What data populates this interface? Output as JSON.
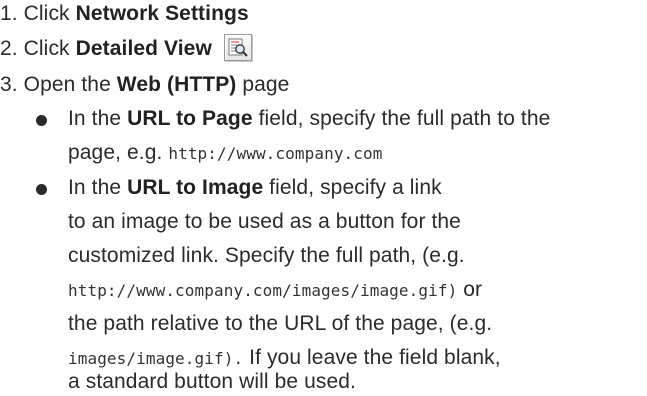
{
  "steps": [
    {
      "num": "1.",
      "text_before": "Click ",
      "bold": "Network Settings"
    },
    {
      "num": "2.",
      "text_before": "Click ",
      "bold": "Detailed View",
      "icon": "detailed-view-icon"
    },
    {
      "num": "3.",
      "text_before": "Open the ",
      "bold": "Web (HTTP)",
      "text_after": " page"
    }
  ],
  "bullets": [
    {
      "lines": [
        {
          "pre": "In the ",
          "bold": "URL to Page",
          "post": " field, specify the full path to the"
        },
        {
          "pre": "page, e.g. ",
          "mono": "http://www.company.com"
        }
      ]
    },
    {
      "lines": [
        {
          "pre": "In the ",
          "bold": "URL to Image",
          "post": " field,  specify a link"
        },
        {
          "pre": "to an image to be used as a button for the"
        },
        {
          "pre": "customized link. Specify the full path, (e.g."
        },
        {
          "mono": "http://www.company.com/images/image.gif)",
          "post": " or"
        },
        {
          "pre": "the path relative to the URL of the page, (e.g."
        },
        {
          "mono": "images/image.gif).",
          "post": "  If you leave the field blank,"
        },
        {
          "pre": " a standard button will be used."
        }
      ]
    }
  ]
}
